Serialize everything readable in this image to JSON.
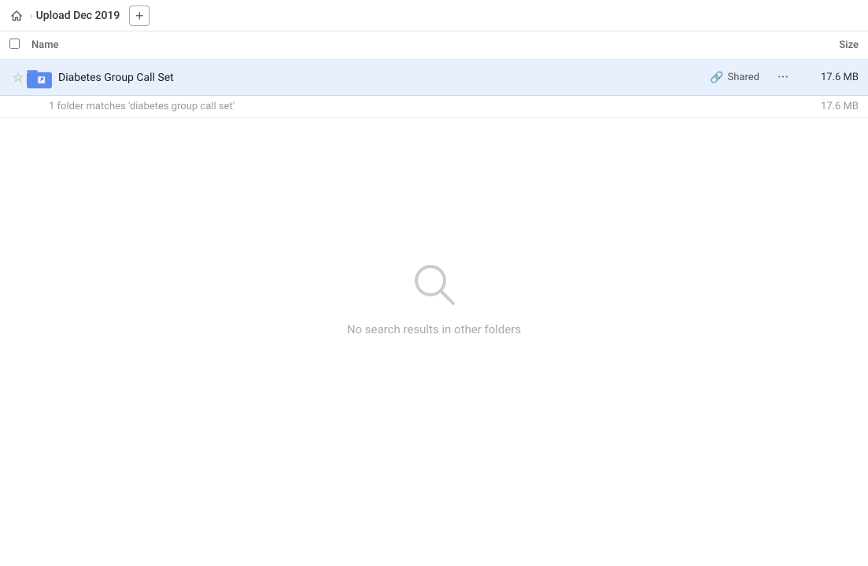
{
  "header": {
    "home_icon": "home-icon",
    "breadcrumb_label": "Upload Dec 2019",
    "add_button_label": "+"
  },
  "table": {
    "col_name": "Name",
    "col_size": "Size"
  },
  "file_row": {
    "name": "Diabetes Group Call Set",
    "shared_label": "Shared",
    "size": "17.6 MB",
    "more_icon": "···"
  },
  "summary": {
    "text": "1 folder matches 'diabetes group call set'",
    "size": "17.6 MB"
  },
  "empty_state": {
    "message": "No search results in other folders"
  }
}
